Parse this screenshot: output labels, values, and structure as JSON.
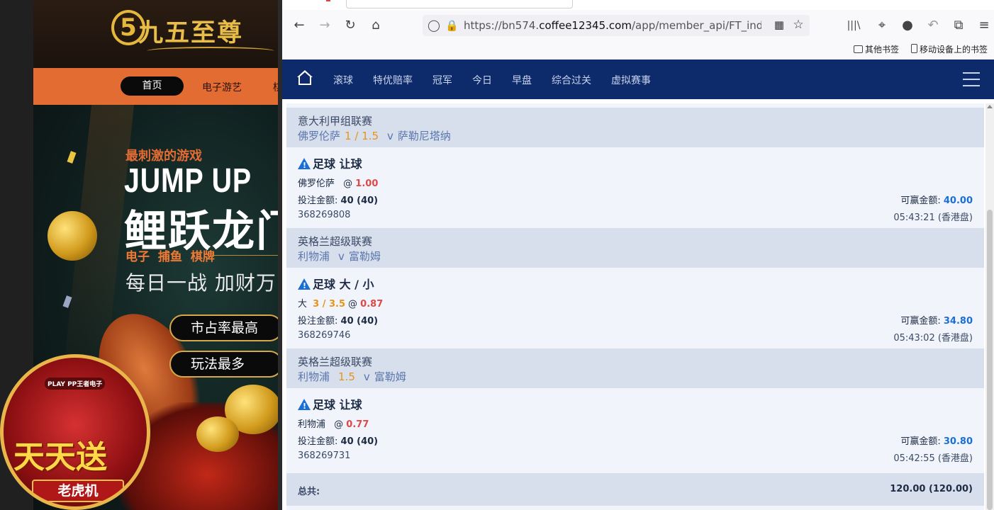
{
  "casino": {
    "logo_mark": "5",
    "logo_text": "九五至尊",
    "nav": {
      "home": "首页",
      "electronic": "电子游艺",
      "more": "棋"
    },
    "banner": {
      "tagline": "最刺激的游戏",
      "headline_en": "JUMP UP",
      "headline_cn": "鲤跃龙门",
      "categories": "电子 捕鱼 棋牌",
      "slogan": "每日一战 加财万",
      "pill_1": "市占率最高",
      "pill_2": "玩法最多"
    },
    "badge": {
      "provider": "PLAY PP王者电子",
      "title": "天天送",
      "subtitle": "老虎机"
    }
  },
  "browser": {
    "url_prefix": "https://bn574.",
    "url_host": "coffee12345.com",
    "url_path": "/app/member_api/FT_index.php?",
    "bookmarks": [
      "其他书签",
      "移动设备上的书签"
    ]
  },
  "sitenav": {
    "items": [
      "滚球",
      "特优赔率",
      "冠军",
      "今日",
      "早盘",
      "综合过关",
      "虚拟赛事"
    ]
  },
  "bets": [
    {
      "league": "意大利甲组联赛",
      "home": "佛罗伦萨",
      "handicap": "1 / 1.5",
      "vs": "v",
      "away": "萨勒尼塔纳",
      "type": "足球 让球",
      "selection": "佛罗伦萨",
      "sel_handicap": "",
      "at": "@",
      "odds": "1.00",
      "stake_label": "投注金额:",
      "stake": "40 (40)",
      "win_label": "可赢金额:",
      "win": "40.00",
      "ref": "368269808",
      "time": "05:43:21 (香港盘)"
    },
    {
      "league": "英格兰超级联赛",
      "home": "利物浦",
      "handicap": "",
      "vs": "v",
      "away": "富勒姆",
      "type": "足球 大 / 小",
      "selection": "大",
      "sel_handicap": "3 / 3.5",
      "at": "@",
      "odds": "0.87",
      "stake_label": "投注金额:",
      "stake": "40 (40)",
      "win_label": "可赢金额:",
      "win": "34.80",
      "ref": "368269746",
      "time": "05:43:02 (香港盘)"
    },
    {
      "league": "英格兰超级联赛",
      "home": "利物浦",
      "handicap": "1.5",
      "vs": "v",
      "away": "富勒姆",
      "type": "足球 让球",
      "selection": "利物浦",
      "sel_handicap": "",
      "at": "@",
      "odds": "0.77",
      "stake_label": "投注金额:",
      "stake": "40 (40)",
      "win_label": "可赢金额:",
      "win": "30.80",
      "ref": "368269731",
      "time": "05:42:55 (香港盘)"
    }
  ],
  "total": {
    "label": "总共:",
    "value": "120.00 (120.00)"
  }
}
